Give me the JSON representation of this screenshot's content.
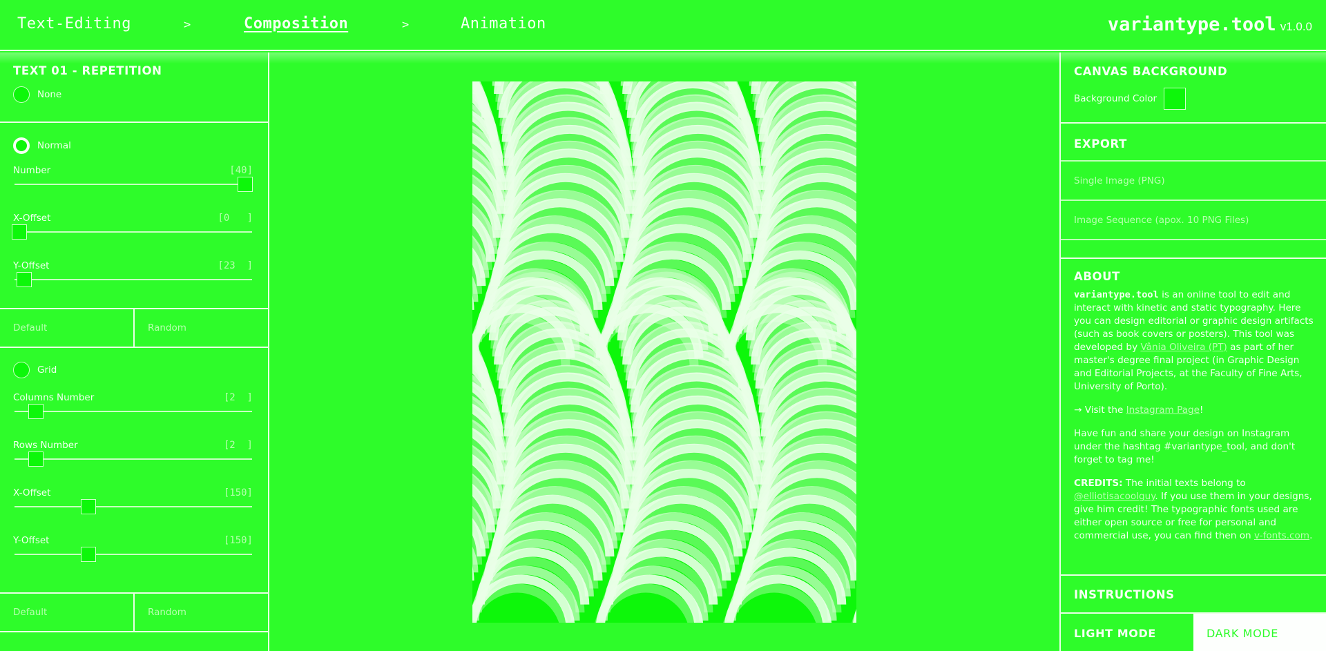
{
  "header": {
    "steps": [
      {
        "label": "Text-Editing",
        "active": false
      },
      {
        "label": "Composition",
        "active": true
      },
      {
        "label": "Animation",
        "active": false
      }
    ],
    "separator": ">",
    "brand_name": "variantype.tool",
    "brand_version": "v1.0.0"
  },
  "left_panel": {
    "title": "TEXT 01 - REPETITION",
    "none_option": {
      "label": "None",
      "checked": false
    },
    "normal": {
      "label": "Normal",
      "checked": true,
      "sliders": [
        {
          "label": "Number",
          "display": "[40]",
          "value": 40,
          "fraction": 0.97
        },
        {
          "label": "X-Offset",
          "display": "[0   ]",
          "value": 0,
          "fraction": 0.02
        },
        {
          "label": "Y-Offset",
          "display": "[23  ]",
          "value": 23,
          "fraction": 0.04
        }
      ],
      "default_label": "Default",
      "random_label": "Random"
    },
    "grid": {
      "label": "Grid",
      "checked": false,
      "sliders": [
        {
          "label": "Columns Number",
          "display": "[2  ]",
          "value": 2,
          "fraction": 0.09
        },
        {
          "label": "Rows Number",
          "display": "[2  ]",
          "value": 2,
          "fraction": 0.09
        },
        {
          "label": "X-Offset",
          "display": "[150]",
          "value": 150,
          "fraction": 0.31
        },
        {
          "label": "Y-Offset",
          "display": "[150]",
          "value": 150,
          "fraction": 0.31
        }
      ],
      "default_label": "Default",
      "random_label": "Random"
    }
  },
  "canvas": {
    "background": "#0df70a",
    "stroke_color": "#eaffe8"
  },
  "right_panel": {
    "canvas_bg_title": "CANVAS BACKGROUND",
    "bg_color_label": "Background Color",
    "bg_color_value": "#0df70a",
    "export_title": "EXPORT",
    "export_items": [
      "Single Image (PNG)",
      "Image Sequence (apox. 10 PNG Files)"
    ],
    "about_title": "ABOUT",
    "about": {
      "brand": "variantype.tool",
      "p1_a": " is an online tool to edit and interact with kinetic and static typography. Here you can design editorial or graphic design artifacts (such as book covers or posters). This tool was developed by ",
      "author_link": "Vânia Oliveira (PT)",
      "p1_b": " as part of her master's degree final project (in Graphic Design and Editorial Projects, at the Faculty of Fine Arts, University of Porto).",
      "visit_prefix": "→ Visit the ",
      "instagram_link": "Instagram Page",
      "visit_suffix": "!",
      "p3": "Have fun and share your design on Instagram under the hashtag #variantype_tool, and don't forget to tag me!",
      "credits_label": "CREDITS:",
      "credits_a": " The initial texts belong to ",
      "credits_link": "@elliotisacoolguy",
      "credits_b": ". If you use them in your designs, give him credit! The typographic fonts used are either open source or free for personal and commercial use, you can find then on ",
      "fonts_link": "v-fonts.com",
      "credits_c": "."
    },
    "instructions_title": "INSTRUCTIONS",
    "light_mode": "LIGHT MODE",
    "dark_mode": "DARK MODE"
  }
}
